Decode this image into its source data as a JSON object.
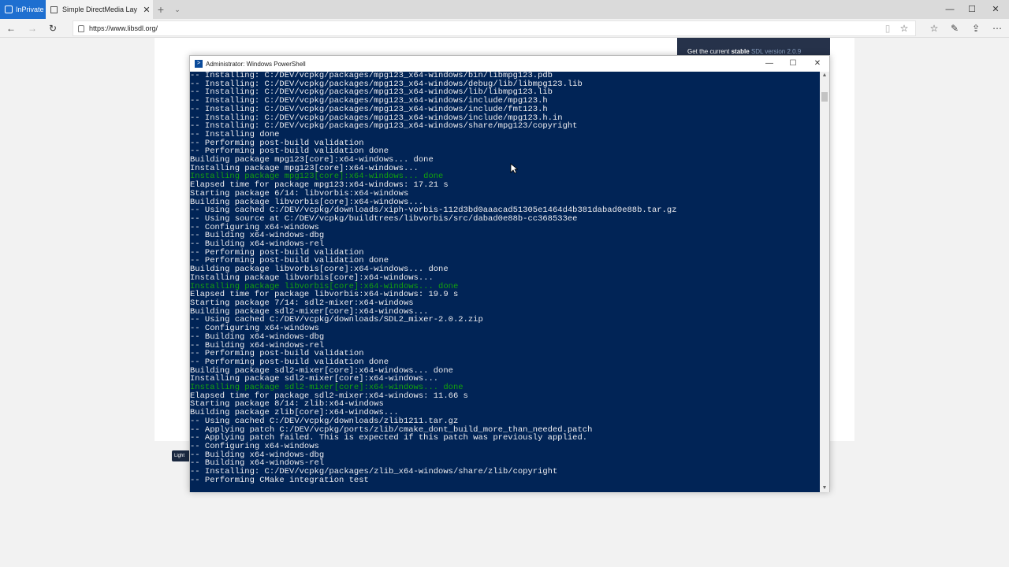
{
  "browser": {
    "inprivate_label": "InPrivate",
    "tab_title": "Simple DirectMedia Lay",
    "url": "https://www.libsdl.org/"
  },
  "webpage": {
    "banner_prefix": "Get the current ",
    "banner_bold": "stable",
    "banner_suffix": " SDL version 2.0.9",
    "badge": "Light"
  },
  "powershell": {
    "title": "Administrator: Windows PowerShell",
    "lines": [
      {
        "text": "-- Installing: C:/DEV/vcpkg/packages/mpg123_x64-windows/bin/libmpg123.pdb",
        "color": "white"
      },
      {
        "text": "-- Installing: C:/DEV/vcpkg/packages/mpg123_x64-windows/debug/lib/libmpg123.lib",
        "color": "white"
      },
      {
        "text": "-- Installing: C:/DEV/vcpkg/packages/mpg123_x64-windows/lib/libmpg123.lib",
        "color": "white"
      },
      {
        "text": "-- Installing: C:/DEV/vcpkg/packages/mpg123_x64-windows/include/mpg123.h",
        "color": "white"
      },
      {
        "text": "-- Installing: C:/DEV/vcpkg/packages/mpg123_x64-windows/include/fmt123.h",
        "color": "white"
      },
      {
        "text": "-- Installing: C:/DEV/vcpkg/packages/mpg123_x64-windows/include/mpg123.h.in",
        "color": "white"
      },
      {
        "text": "-- Installing: C:/DEV/vcpkg/packages/mpg123_x64-windows/share/mpg123/copyright",
        "color": "white"
      },
      {
        "text": "-- Installing done",
        "color": "white"
      },
      {
        "text": "-- Performing post-build validation",
        "color": "white"
      },
      {
        "text": "-- Performing post-build validation done",
        "color": "white"
      },
      {
        "text": "Building package mpg123[core]:x64-windows... done",
        "color": "white"
      },
      {
        "text": "Installing package mpg123[core]:x64-windows...",
        "color": "white"
      },
      {
        "text": "Installing package mpg123[core]:x64-windows... done",
        "color": "green"
      },
      {
        "text": "Elapsed time for package mpg123:x64-windows: 17.21 s",
        "color": "white"
      },
      {
        "text": "Starting package 6/14: libvorbis:x64-windows",
        "color": "white"
      },
      {
        "text": "Building package libvorbis[core]:x64-windows...",
        "color": "white"
      },
      {
        "text": "-- Using cached C:/DEV/vcpkg/downloads/xiph-vorbis-112d3bd0aaacad51305e1464d4b381dabad0e88b.tar.gz",
        "color": "white"
      },
      {
        "text": "-- Using source at C:/DEV/vcpkg/buildtrees/libvorbis/src/dabad0e88b-cc368533ee",
        "color": "white"
      },
      {
        "text": "-- Configuring x64-windows",
        "color": "white"
      },
      {
        "text": "-- Building x64-windows-dbg",
        "color": "white"
      },
      {
        "text": "-- Building x64-windows-rel",
        "color": "white"
      },
      {
        "text": "-- Performing post-build validation",
        "color": "white"
      },
      {
        "text": "-- Performing post-build validation done",
        "color": "white"
      },
      {
        "text": "Building package libvorbis[core]:x64-windows... done",
        "color": "white"
      },
      {
        "text": "Installing package libvorbis[core]:x64-windows...",
        "color": "white"
      },
      {
        "text": "Installing package libvorbis[core]:x64-windows... done",
        "color": "green"
      },
      {
        "text": "Elapsed time for package libvorbis:x64-windows: 19.9 s",
        "color": "white"
      },
      {
        "text": "Starting package 7/14: sdl2-mixer:x64-windows",
        "color": "white"
      },
      {
        "text": "Building package sdl2-mixer[core]:x64-windows...",
        "color": "white"
      },
      {
        "text": "-- Using cached C:/DEV/vcpkg/downloads/SDL2_mixer-2.0.2.zip",
        "color": "white"
      },
      {
        "text": "-- Configuring x64-windows",
        "color": "white"
      },
      {
        "text": "-- Building x64-windows-dbg",
        "color": "white"
      },
      {
        "text": "-- Building x64-windows-rel",
        "color": "white"
      },
      {
        "text": "-- Performing post-build validation",
        "color": "white"
      },
      {
        "text": "-- Performing post-build validation done",
        "color": "white"
      },
      {
        "text": "Building package sdl2-mixer[core]:x64-windows... done",
        "color": "white"
      },
      {
        "text": "Installing package sdl2-mixer[core]:x64-windows...",
        "color": "white"
      },
      {
        "text": "Installing package sdl2-mixer[core]:x64-windows... done",
        "color": "green"
      },
      {
        "text": "Elapsed time for package sdl2-mixer:x64-windows: 11.66 s",
        "color": "white"
      },
      {
        "text": "Starting package 8/14: zlib:x64-windows",
        "color": "white"
      },
      {
        "text": "Building package zlib[core]:x64-windows...",
        "color": "white"
      },
      {
        "text": "-- Using cached C:/DEV/vcpkg/downloads/zlib1211.tar.gz",
        "color": "white"
      },
      {
        "text": "-- Applying patch C:/DEV/vcpkg/ports/zlib/cmake_dont_build_more_than_needed.patch",
        "color": "white"
      },
      {
        "text": "-- Applying patch failed. This is expected if this patch was previously applied.",
        "color": "white"
      },
      {
        "text": "-- Configuring x64-windows",
        "color": "white"
      },
      {
        "text": "-- Building x64-windows-dbg",
        "color": "white"
      },
      {
        "text": "-- Building x64-windows-rel",
        "color": "white"
      },
      {
        "text": "-- Installing: C:/DEV/vcpkg/packages/zlib_x64-windows/share/zlib/copyright",
        "color": "white"
      },
      {
        "text": "-- Performing CMake integration test",
        "color": "white"
      }
    ]
  }
}
